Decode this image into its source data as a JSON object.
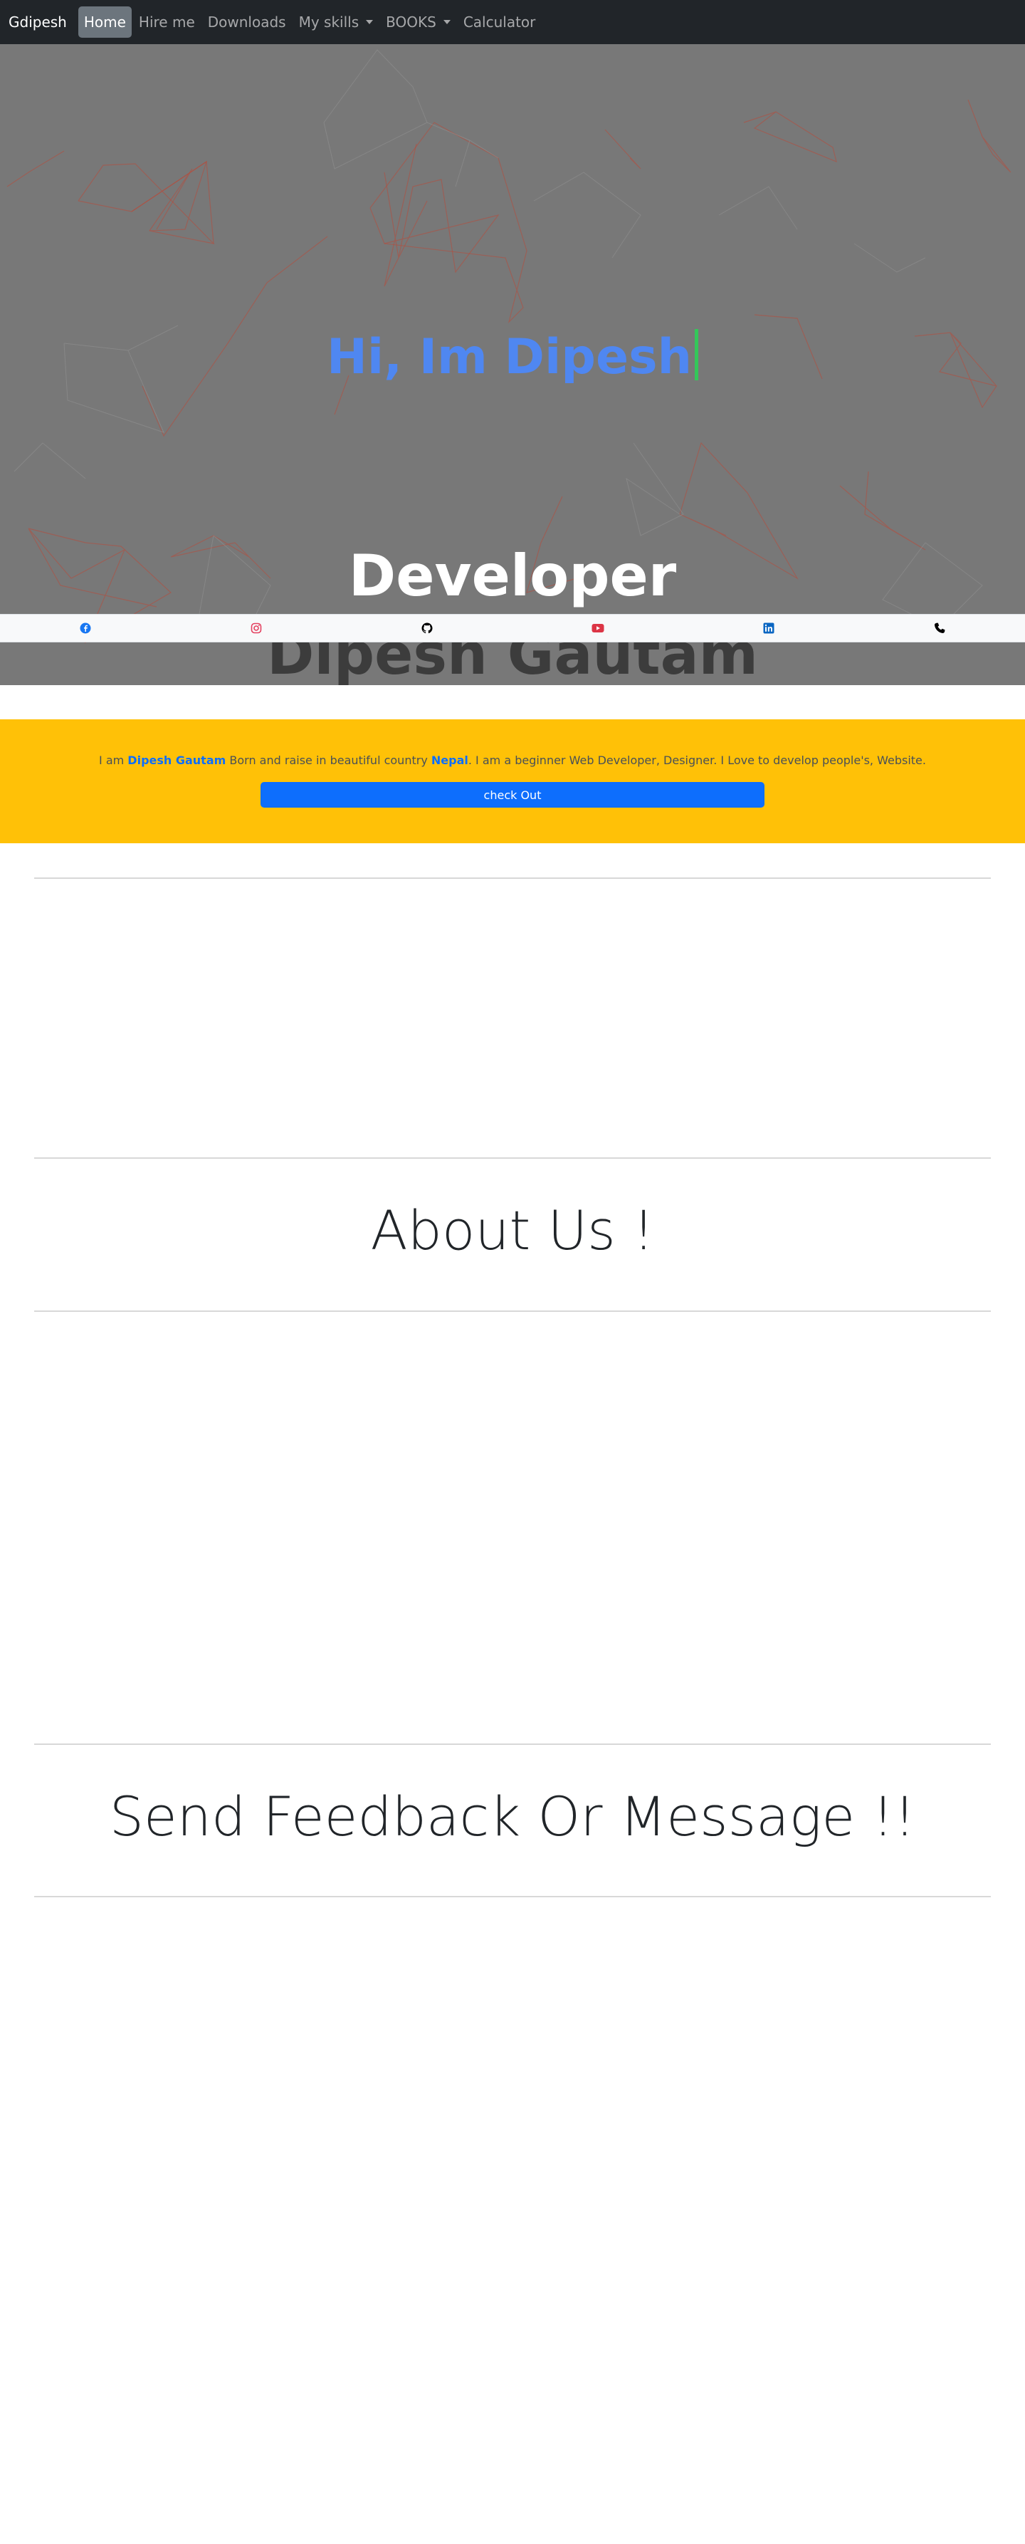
{
  "navbar": {
    "brand": "Gdipesh",
    "items": [
      {
        "label": "Home",
        "active": true,
        "dropdown": false
      },
      {
        "label": "Hire me",
        "active": false,
        "dropdown": false
      },
      {
        "label": "Downloads",
        "active": false,
        "dropdown": false
      },
      {
        "label": "My skills",
        "active": false,
        "dropdown": true
      },
      {
        "label": "BOOKS",
        "active": false,
        "dropdown": true
      },
      {
        "label": "Calculator",
        "active": false,
        "dropdown": false
      }
    ]
  },
  "hero": {
    "greeting": "Hi, Im Dipesh",
    "role": "Developer",
    "name": "Dipesh Gautam",
    "background_color": "#787878",
    "line_color": "#b84a3a"
  },
  "social": [
    {
      "icon": "facebook-icon",
      "color": "#1877f2"
    },
    {
      "icon": "instagram-icon",
      "color": "#e4405f"
    },
    {
      "icon": "github-icon",
      "color": "#000000"
    },
    {
      "icon": "youtube-icon",
      "color": "#dc3545"
    },
    {
      "icon": "linkedin-icon",
      "color": "#0a66c2"
    },
    {
      "icon": "phone-icon",
      "color": "#000000"
    }
  ],
  "intro": {
    "prefix": "I am ",
    "name": "Dipesh Gautam",
    "middle": " Born and raise in beautiful country ",
    "country": "Nepal",
    "suffix": ". I am a beginner Web Developer, Designer. I Love to develop people's, Website.",
    "button": "check Out",
    "background_color": "#ffc107"
  },
  "sections": {
    "about": "About Us !",
    "feedback": "Send Feedback Or Message !!"
  }
}
